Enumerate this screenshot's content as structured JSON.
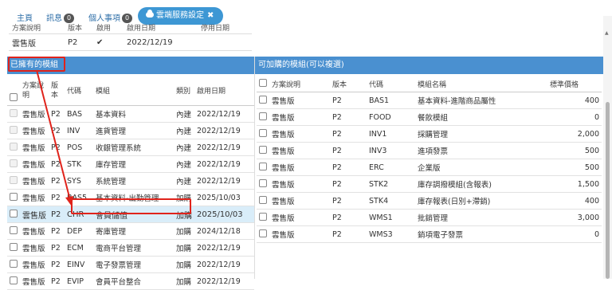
{
  "tabs": [
    {
      "label": "主頁"
    },
    {
      "label": "訊息",
      "badge": "0"
    },
    {
      "label": "個人事項",
      "badge": "0"
    }
  ],
  "active_tab": {
    "label": "雲端服務設定",
    "close": "✖"
  },
  "info": {
    "headers": [
      "方案說明",
      "版本",
      "啟用",
      "啟用日期",
      "停用日期"
    ],
    "row": {
      "plan": "雲售版",
      "version": "P2",
      "enabled": "✔",
      "date": "2022/12/19",
      "stop": ""
    }
  },
  "owned": {
    "title": "已擁有的模組",
    "headers": [
      "方案說明",
      "版本",
      "代碼",
      "模組",
      "類別",
      "啟用日期"
    ],
    "rows": [
      {
        "plan": "雲售版",
        "version": "P2",
        "code": "BAS",
        "name": "基本資料",
        "type": "內建",
        "date": "2022/12/19"
      },
      {
        "plan": "雲售版",
        "version": "P2",
        "code": "INV",
        "name": "進貨管理",
        "type": "內建",
        "date": "2022/12/19"
      },
      {
        "plan": "雲售版",
        "version": "P2",
        "code": "POS",
        "name": "收銀管理系統",
        "type": "內建",
        "date": "2022/12/19"
      },
      {
        "plan": "雲售版",
        "version": "P2",
        "code": "STK",
        "name": "庫存管理",
        "type": "內建",
        "date": "2022/12/19"
      },
      {
        "plan": "雲售版",
        "version": "P2",
        "code": "SYS",
        "name": "系統管理",
        "type": "內建",
        "date": "2022/12/19"
      },
      {
        "plan": "雲售版",
        "version": "P2",
        "code": "BAS5",
        "name": "基本資料-出勤管理",
        "type": "加購",
        "date": "2025/10/03"
      },
      {
        "plan": "雲售版",
        "version": "P2",
        "code": "CHR",
        "name": "會員儲值",
        "type": "加購",
        "date": "2025/10/03"
      },
      {
        "plan": "雲售版",
        "version": "P2",
        "code": "DEP",
        "name": "寄庫管理",
        "type": "加購",
        "date": "2024/12/18"
      },
      {
        "plan": "雲售版",
        "version": "P2",
        "code": "ECM",
        "name": "電商平台管理",
        "type": "加購",
        "date": "2022/12/19"
      },
      {
        "plan": "雲售版",
        "version": "P2",
        "code": "EINV",
        "name": "電子發票管理",
        "type": "加購",
        "date": "2022/12/19"
      },
      {
        "plan": "雲售版",
        "version": "P2",
        "code": "EVIP",
        "name": "會員平台整合",
        "type": "加購",
        "date": "2022/12/19"
      }
    ]
  },
  "available": {
    "title": "可加購的模組(可以複選)",
    "headers": [
      "方案說明",
      "版本",
      "代碼",
      "模組名稱",
      "標準價格"
    ],
    "rows": [
      {
        "plan": "雲售版",
        "version": "P2",
        "code": "BAS1",
        "name": "基本資料-進階商品屬性",
        "price": "400"
      },
      {
        "plan": "雲售版",
        "version": "P2",
        "code": "FOOD",
        "name": "餐飲模組",
        "price": "0"
      },
      {
        "plan": "雲售版",
        "version": "P2",
        "code": "INV1",
        "name": "採購管理",
        "price": "2,000"
      },
      {
        "plan": "雲售版",
        "version": "P2",
        "code": "INV3",
        "name": "進項發票",
        "price": "500"
      },
      {
        "plan": "雲售版",
        "version": "P2",
        "code": "ERC",
        "name": "企業版",
        "price": "500"
      },
      {
        "plan": "雲售版",
        "version": "P2",
        "code": "STK2",
        "name": "庫存調撥模組(含報表)",
        "price": "1,500"
      },
      {
        "plan": "雲售版",
        "version": "P2",
        "code": "STK4",
        "name": "庫存報表(日別+滯銷)",
        "price": "400"
      },
      {
        "plan": "雲售版",
        "version": "P2",
        "code": "WMS1",
        "name": "批銷管理",
        "price": "3,000"
      },
      {
        "plan": "雲售版",
        "version": "P2",
        "code": "WMS3",
        "name": "銷項電子發票",
        "price": "0"
      }
    ]
  },
  "colors": {
    "accent": "#3d97d4",
    "panel": "#4a90d0",
    "highlight": "#e0231b",
    "selected_row": "#d9edf9"
  }
}
